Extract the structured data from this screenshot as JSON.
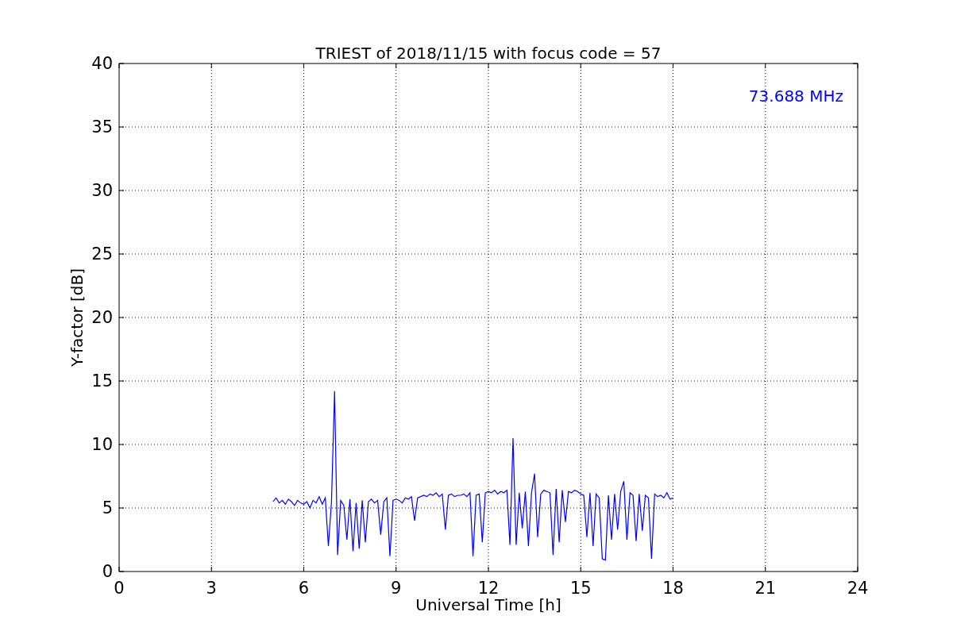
{
  "chart_data": {
    "type": "line",
    "title": "TRIEST of 2018/11/15 with focus code = 57",
    "xlabel": "Universal Time [h]",
    "ylabel": "Y-factor [dB]",
    "grid": true,
    "xlim": [
      0,
      24
    ],
    "ylim": [
      0,
      40
    ],
    "xticks": [
      0,
      3,
      6,
      9,
      12,
      15,
      18,
      21,
      24
    ],
    "yticks": [
      0,
      5,
      10,
      15,
      20,
      25,
      30,
      35,
      40
    ],
    "x": [
      5.0,
      5.1,
      5.2,
      5.3,
      5.4,
      5.5,
      5.6,
      5.7,
      5.8,
      5.9,
      6.0,
      6.1,
      6.2,
      6.3,
      6.4,
      6.5,
      6.6,
      6.7,
      6.8,
      6.9,
      7.0,
      7.1,
      7.2,
      7.3,
      7.4,
      7.5,
      7.6,
      7.7,
      7.8,
      7.9,
      8.0,
      8.1,
      8.2,
      8.3,
      8.4,
      8.5,
      8.6,
      8.7,
      8.8,
      8.9,
      9.0,
      9.1,
      9.2,
      9.3,
      9.4,
      9.5,
      9.6,
      9.7,
      9.8,
      9.9,
      10.0,
      10.1,
      10.2,
      10.3,
      10.4,
      10.5,
      10.6,
      10.7,
      10.8,
      10.9,
      11.0,
      11.1,
      11.2,
      11.3,
      11.4,
      11.5,
      11.6,
      11.7,
      11.8,
      11.9,
      12.0,
      12.1,
      12.2,
      12.3,
      12.4,
      12.5,
      12.6,
      12.7,
      12.8,
      12.9,
      13.0,
      13.1,
      13.2,
      13.3,
      13.4,
      13.5,
      13.6,
      13.7,
      13.8,
      13.9,
      14.0,
      14.1,
      14.2,
      14.3,
      14.4,
      14.5,
      14.6,
      14.7,
      14.8,
      14.9,
      15.0,
      15.1,
      15.2,
      15.3,
      15.4,
      15.5,
      15.6,
      15.7,
      15.8,
      15.9,
      16.0,
      16.1,
      16.2,
      16.3,
      16.4,
      16.5,
      16.6,
      16.7,
      16.8,
      16.9,
      17.0,
      17.1,
      17.2,
      17.3,
      17.4,
      17.5,
      17.6,
      17.7,
      17.8,
      17.9,
      18.0
    ],
    "series": [
      {
        "name": "73.688 MHz",
        "color": "#0000ff",
        "values": [
          5.5,
          5.8,
          5.4,
          5.6,
          5.3,
          5.7,
          5.5,
          5.2,
          5.6,
          5.4,
          5.3,
          5.5,
          5.0,
          5.6,
          5.4,
          5.9,
          5.3,
          5.8,
          2.0,
          5.5,
          14.2,
          1.3,
          5.6,
          5.2,
          2.5,
          5.7,
          1.6,
          5.4,
          1.8,
          5.6,
          2.3,
          5.5,
          5.7,
          5.4,
          5.6,
          2.9,
          5.5,
          5.8,
          1.2,
          5.6,
          5.7,
          5.6,
          5.4,
          5.8,
          5.7,
          5.9,
          4.0,
          5.8,
          5.9,
          6.0,
          5.9,
          6.1,
          6.0,
          6.2,
          5.9,
          6.1,
          3.3,
          6.0,
          6.1,
          5.9,
          6.0,
          6.0,
          6.1,
          5.9,
          6.2,
          1.2,
          6.0,
          6.1,
          2.3,
          6.2,
          6.3,
          6.2,
          6.4,
          6.1,
          6.3,
          6.2,
          6.4,
          2.1,
          10.5,
          2.1,
          6.2,
          3.4,
          6.3,
          2.0,
          6.2,
          7.7,
          2.7,
          6.1,
          6.4,
          6.3,
          6.2,
          1.3,
          6.5,
          2.3,
          6.4,
          3.9,
          6.3,
          6.2,
          6.4,
          6.3,
          6.1,
          6.0,
          2.7,
          6.2,
          2.0,
          6.1,
          5.8,
          1.0,
          0.9,
          6.0,
          2.5,
          6.1,
          3.3,
          6.3,
          7.1,
          2.5,
          6.2,
          6.0,
          2.4,
          6.1,
          3.2,
          6.0,
          5.8,
          1.0,
          6.1,
          5.9,
          6.0,
          5.8,
          6.2,
          5.7,
          5.8
        ]
      }
    ]
  }
}
